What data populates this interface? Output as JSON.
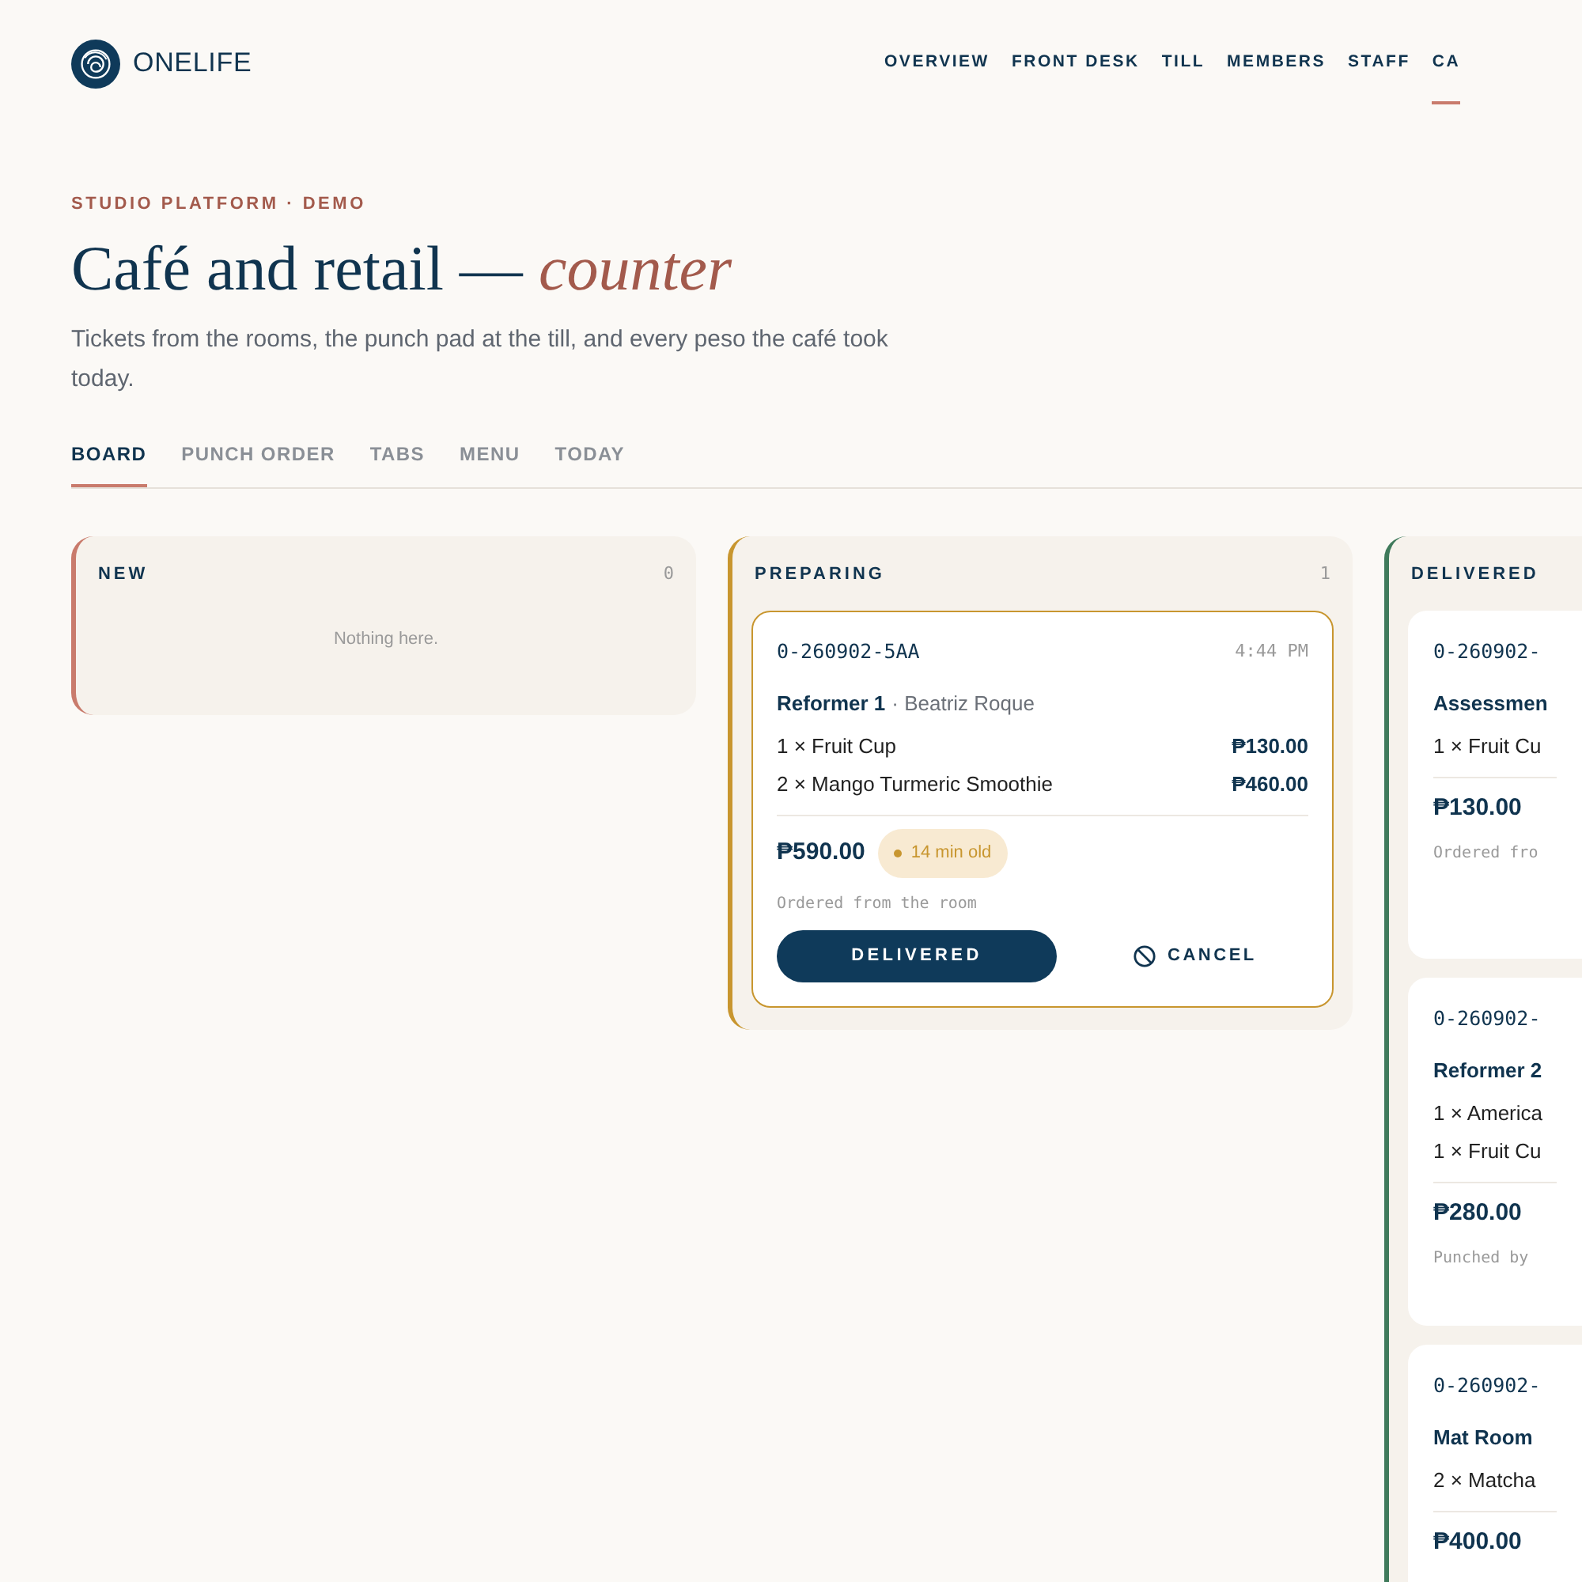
{
  "brand": {
    "name": "ONELIFE"
  },
  "nav": [
    {
      "label": "OVERVIEW",
      "selected": false
    },
    {
      "label": "FRONT DESK",
      "selected": false
    },
    {
      "label": "TILL",
      "selected": false
    },
    {
      "label": "MEMBERS",
      "selected": false
    },
    {
      "label": "STAFF",
      "selected": false
    },
    {
      "label": "CA",
      "selected": true
    }
  ],
  "header": {
    "eyebrow": "STUDIO PLATFORM · DEMO",
    "title": "Café and retail —",
    "title_accent": "counter",
    "subtitle": "Tickets from the rooms, the punch pad at the till, and every peso the café took today."
  },
  "tabs": [
    {
      "label": "BOARD",
      "selected": true
    },
    {
      "label": "PUNCH ORDER",
      "selected": false
    },
    {
      "label": "TABS",
      "selected": false
    },
    {
      "label": "MENU",
      "selected": false
    },
    {
      "label": "TODAY",
      "selected": false
    }
  ],
  "columns": [
    {
      "title": "NEW",
      "count": "0",
      "color": "#c97b6c",
      "empty_text": "Nothing here."
    },
    {
      "title": "PREPARING",
      "count": "1",
      "color": "#c8962f",
      "orders": [
        {
          "id": "0-260902-5AA",
          "time": "4:44 PM",
          "location": "Reformer 1",
          "person": "· Beatriz Roque",
          "items": [
            {
              "text": "1 × Fruit Cup",
              "price": "₱130.00"
            },
            {
              "text": "2 × Mango Turmeric Smoothie",
              "price": "₱460.00"
            }
          ],
          "total": "₱590.00",
          "age": "14 min old",
          "note": "Ordered from the room",
          "primary_action": "DELIVERED",
          "secondary_action": "CANCEL"
        }
      ]
    },
    {
      "title": "DELIVERED",
      "color": "#3f7a5b",
      "orders": [
        {
          "id": "0-260902-",
          "location": "Assessmen",
          "items": [
            {
              "text": "1 × Fruit Cu"
            }
          ],
          "total": "₱130.00",
          "note": "Ordered fro"
        },
        {
          "id": "0-260902-",
          "location": "Reformer 2",
          "items": [
            {
              "text": "1 × America"
            },
            {
              "text": "1 × Fruit Cu"
            }
          ],
          "total": "₱280.00",
          "note": "Punched by"
        },
        {
          "id": "0-260902-",
          "location": "Mat Room",
          "items": [
            {
              "text": "2 × Matcha"
            }
          ],
          "total": "₱400.00"
        }
      ]
    }
  ]
}
